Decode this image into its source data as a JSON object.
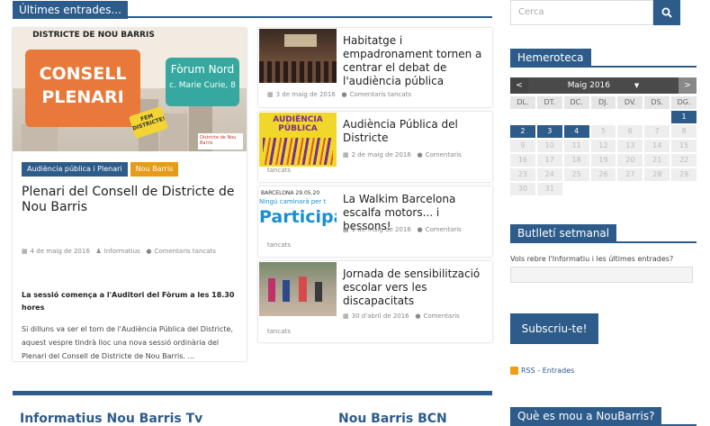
{
  "main": {
    "section_title": "Últimes entrades...",
    "featured": {
      "image": {
        "title": "DISTRICTE DE NOU BARRIS",
        "card1": "CONSELL PLENARI",
        "card2_line1": "Fòrum Nord",
        "card2_line2": "c. Marie Curie, 8",
        "badge": "FEM DISTRICTE!",
        "logo": "Districte de Nou Barris"
      },
      "tags": [
        "Audiència pública i Plenari",
        "Nou Barris"
      ],
      "title": "Plenari del Consell de Districte de Nou Barris",
      "date": "4 de maig de 2016",
      "author": "Informatius",
      "comments": "Comentaris tancats",
      "lead": "La sessió comença a l'Auditori del Fòrum a les 18.30 hores",
      "excerpt": "Si dilluns va ser el torn de l'Audiència Pública del Districte, aquest vespre tindrà lloc una nova sessió ordinària del Plenari del Consell de Districte de Nou Barris. ..."
    },
    "posts": [
      {
        "title": "Habitatge i empadronament tornen a centrar el debat de l'audiència pública",
        "date": "3 de maig de 2016",
        "comments": "Comentaris tancats"
      },
      {
        "title": "Audiència Pública del Districte",
        "date": "2 de maig de 2016",
        "comments": "Comentaris",
        "comments2": "tancats",
        "thumb_line1": "AUDIÈNCIA",
        "thumb_line2": "PÚBLICA"
      },
      {
        "title": "La Walkim Barcelona escalfa motors... i bessons!",
        "date": "1 de maig de 2016",
        "comments": "Comentaris",
        "comments2": "tancats",
        "thumb_line1": "BARCELONA 29.05.20",
        "thumb_line2": "Ningú caminarà per t",
        "thumb_line3": "Participa"
      },
      {
        "title": "Jornada de sensibilització escolar vers les discapacitats",
        "date": "30 d'abril de 2016",
        "comments": "Comentaris",
        "comments2": "tancats"
      }
    ],
    "bottom_left": "Informatius Nou Barris Tv",
    "bottom_right": "Nou Barris BCN"
  },
  "sidebar": {
    "search_placeholder": "Cerca",
    "archive_title": "Hemeroteca",
    "calendar": {
      "prev": "<",
      "next": ">",
      "month": "Maig 2016",
      "caret": "▼",
      "weekdays": [
        "DL.",
        "DT.",
        "DC.",
        "DJ.",
        "DV.",
        "DS.",
        "DG."
      ],
      "days": [
        "",
        "",
        "",
        "",
        "",
        "",
        "1",
        "2",
        "3",
        "4",
        "5",
        "6",
        "7",
        "8",
        "9",
        "10",
        "11",
        "12",
        "13",
        "14",
        "15",
        "16",
        "17",
        "18",
        "19",
        "20",
        "21",
        "22",
        "23",
        "24",
        "25",
        "26",
        "27",
        "28",
        "29",
        "30",
        "31",
        "",
        "",
        "",
        "",
        ""
      ],
      "active_days": [
        "1",
        "2",
        "3",
        "4"
      ]
    },
    "newsletter_title": "Butlletí setmanal",
    "newsletter_text": "Vols rebre l'Informatiu i les últimes entrades?",
    "subscribe_label": "Subscriu-te!",
    "rss_label": "RSS - Entrades",
    "whats_on_title": "Què es mou a NouBarris?"
  },
  "colors": {
    "accent": "#2d5b8a",
    "orange": "#e89a1a"
  }
}
